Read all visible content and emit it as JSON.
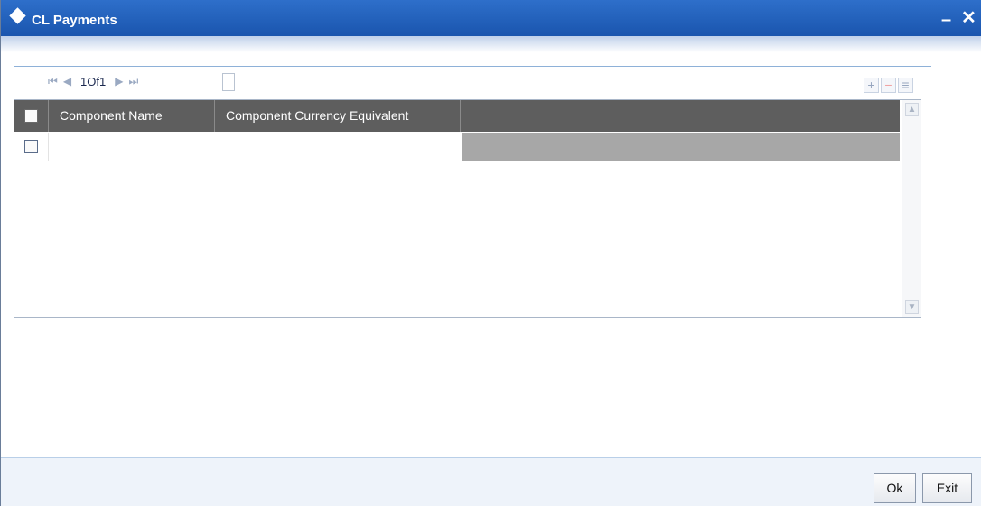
{
  "window": {
    "title": "CL Payments",
    "minimize_glyph": "–",
    "close_glyph": "✕"
  },
  "pager": {
    "first_glyph": "⏮",
    "prev_glyph": "◀",
    "count_text": "1Of1",
    "next_glyph": "▶",
    "last_glyph": "⏭"
  },
  "grid_tools": {
    "add_glyph": "+",
    "delete_glyph": "−",
    "view_glyph": "≡"
  },
  "grid": {
    "columns": [
      "Component Name",
      "Component Currency Equivalent"
    ],
    "rows": [
      {
        "component_name": "",
        "component_currency_equivalent": ""
      }
    ]
  },
  "scrollbar": {
    "up_glyph": "▲",
    "down_glyph": "▼"
  },
  "footer": {
    "ok_label": "Ok",
    "exit_label": "Exit"
  },
  "colors": {
    "title_bar": "#1d5ab2",
    "grid_header": "#5e5e5e",
    "grid_fill": "#a7a7a7",
    "footer_bg": "#eef3fa"
  },
  "icons": [
    "diamond-icon",
    "minimize-icon",
    "close-icon",
    "first-page-icon",
    "prev-page-icon",
    "next-page-icon",
    "last-page-icon",
    "add-row-icon",
    "delete-row-icon",
    "single-view-icon",
    "scroll-up-icon",
    "scroll-down-icon"
  ]
}
